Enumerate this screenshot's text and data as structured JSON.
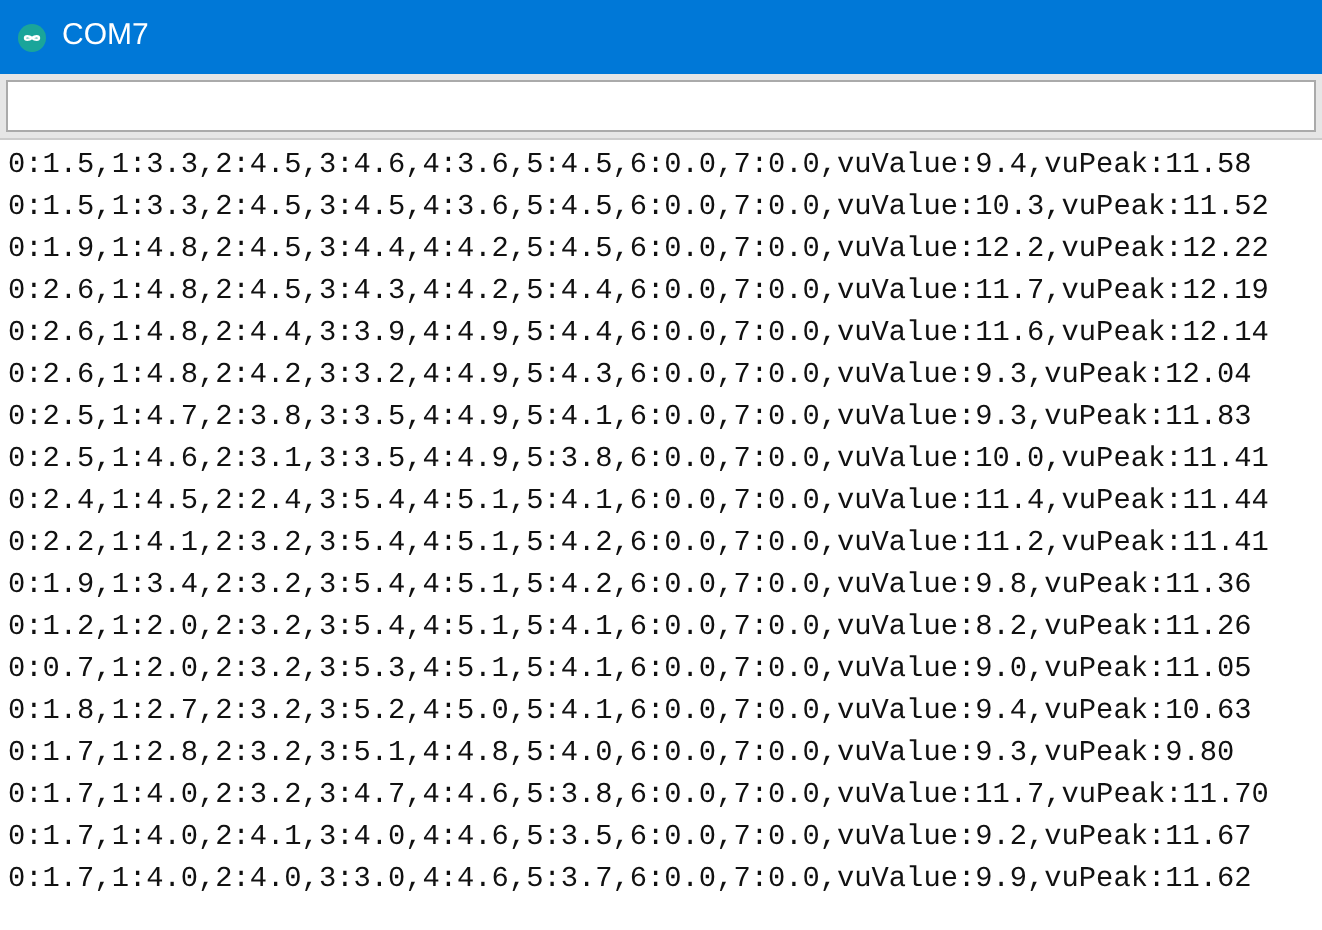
{
  "window": {
    "title": "COM7"
  },
  "lines": [
    "0:1.5,1:3.3,2:4.5,3:4.6,4:3.6,5:4.5,6:0.0,7:0.0,vuValue:9.4,vuPeak:11.58",
    "0:1.5,1:3.3,2:4.5,3:4.5,4:3.6,5:4.5,6:0.0,7:0.0,vuValue:10.3,vuPeak:11.52",
    "0:1.9,1:4.8,2:4.5,3:4.4,4:4.2,5:4.5,6:0.0,7:0.0,vuValue:12.2,vuPeak:12.22",
    "0:2.6,1:4.8,2:4.5,3:4.3,4:4.2,5:4.4,6:0.0,7:0.0,vuValue:11.7,vuPeak:12.19",
    "0:2.6,1:4.8,2:4.4,3:3.9,4:4.9,5:4.4,6:0.0,7:0.0,vuValue:11.6,vuPeak:12.14",
    "0:2.6,1:4.8,2:4.2,3:3.2,4:4.9,5:4.3,6:0.0,7:0.0,vuValue:9.3,vuPeak:12.04",
    "0:2.5,1:4.7,2:3.8,3:3.5,4:4.9,5:4.1,6:0.0,7:0.0,vuValue:9.3,vuPeak:11.83",
    "0:2.5,1:4.6,2:3.1,3:3.5,4:4.9,5:3.8,6:0.0,7:0.0,vuValue:10.0,vuPeak:11.41",
    "0:2.4,1:4.5,2:2.4,3:5.4,4:5.1,5:4.1,6:0.0,7:0.0,vuValue:11.4,vuPeak:11.44",
    "0:2.2,1:4.1,2:3.2,3:5.4,4:5.1,5:4.2,6:0.0,7:0.0,vuValue:11.2,vuPeak:11.41",
    "0:1.9,1:3.4,2:3.2,3:5.4,4:5.1,5:4.2,6:0.0,7:0.0,vuValue:9.8,vuPeak:11.36",
    "0:1.2,1:2.0,2:3.2,3:5.4,4:5.1,5:4.1,6:0.0,7:0.0,vuValue:8.2,vuPeak:11.26",
    "0:0.7,1:2.0,2:3.2,3:5.3,4:5.1,5:4.1,6:0.0,7:0.0,vuValue:9.0,vuPeak:11.05",
    "0:1.8,1:2.7,2:3.2,3:5.2,4:5.0,5:4.1,6:0.0,7:0.0,vuValue:9.4,vuPeak:10.63",
    "0:1.7,1:2.8,2:3.2,3:5.1,4:4.8,5:4.0,6:0.0,7:0.0,vuValue:9.3,vuPeak:9.80",
    "0:1.7,1:4.0,2:3.2,3:4.7,4:4.6,5:3.8,6:0.0,7:0.0,vuValue:11.7,vuPeak:11.70",
    "0:1.7,1:4.0,2:4.1,3:4.0,4:4.6,5:3.5,6:0.0,7:0.0,vuValue:9.2,vuPeak:11.67",
    "0:1.7,1:4.0,2:4.0,3:3.0,4:4.6,5:3.7,6:0.0,7:0.0,vuValue:9.9,vuPeak:11.62"
  ]
}
